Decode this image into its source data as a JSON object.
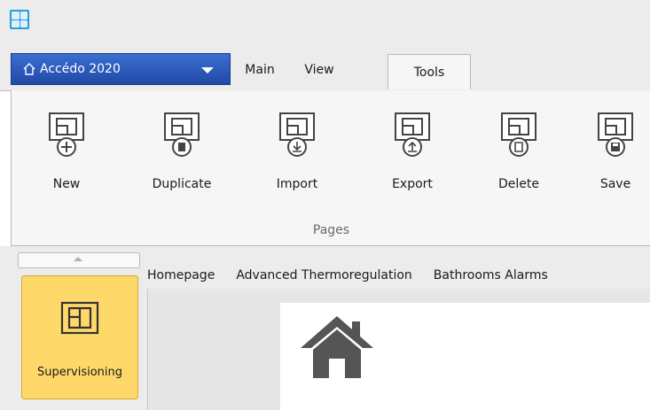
{
  "app": {
    "name": "Accédo 2020"
  },
  "tabs": [
    {
      "label": "Main",
      "active": false
    },
    {
      "label": "View",
      "active": false
    },
    {
      "label": "Tools",
      "active": true
    }
  ],
  "ribbon": {
    "buttons": [
      {
        "label": "New",
        "icon": "new-page-icon"
      },
      {
        "label": "Duplicate",
        "icon": "duplicate-page-icon"
      },
      {
        "label": "Import",
        "icon": "import-page-icon"
      },
      {
        "label": "Export",
        "icon": "export-page-icon"
      },
      {
        "label": "Delete",
        "icon": "delete-page-icon"
      },
      {
        "label": "Save",
        "icon": "save-page-icon"
      }
    ],
    "group_label": "Pages"
  },
  "sidebar": {
    "item_label": "Supervisioning",
    "item_icon": "supervisioning-icon"
  },
  "page_tabs": [
    "Homepage",
    "Advanced Thermoregulation",
    "Bathrooms Alarms"
  ],
  "colors": {
    "accent_blue": "#2a57b8",
    "selected_yellow": "#ffd86a",
    "ribbon_bg": "#f6f6f6"
  }
}
